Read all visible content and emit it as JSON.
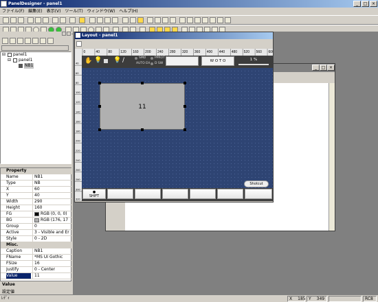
{
  "app": {
    "title": "PanelDesigner - panel1"
  },
  "menu": [
    "ファイル(F)",
    "編集(E)",
    "表示(V)",
    "ツール(T)",
    "ウィンドウ(W)",
    "ヘルプ(H)"
  ],
  "tree": {
    "root": "panel1",
    "child": "panel1",
    "leaf": "NB1"
  },
  "properties": {
    "header": "Property",
    "rows": [
      [
        "Name",
        "NB1"
      ],
      [
        "Type",
        "NB"
      ],
      [
        "X",
        "60"
      ],
      [
        "Y",
        "40"
      ],
      [
        "Width",
        "290"
      ],
      [
        "Height",
        "160"
      ],
      [
        "FG",
        "RGB (0, 0, 0)"
      ],
      [
        "BG",
        "RGB (176, 17"
      ],
      [
        "Group",
        "0"
      ],
      [
        "Active",
        "3 - Visible and Er"
      ],
      [
        "Style",
        "0 - 2D"
      ]
    ],
    "misc_header": "Misc.",
    "misc_rows": [
      [
        "Caption",
        "NB1"
      ],
      [
        "FName",
        "*MS UI Gothic"
      ],
      [
        "FSize",
        "16"
      ],
      [
        "Justify",
        "0 - Center"
      ],
      [
        "Value",
        "11"
      ]
    ],
    "fg_color": "#000000",
    "bg_color": "#b0b0b0"
  },
  "desc": {
    "title": "Value",
    "text": "設定値"
  },
  "layout_window": {
    "title": "Layout - panel1"
  },
  "ruler_marks": [
    "0",
    "40",
    "80",
    "120",
    "160",
    "200",
    "240",
    "280",
    "320",
    "360",
    "400",
    "440",
    "480",
    "520",
    "560",
    "600"
  ],
  "ruler_v_marks": [
    "40",
    "60",
    "80",
    "100",
    "120",
    "140",
    "160",
    "180",
    "200",
    "220",
    "240",
    "260",
    "280",
    "300",
    "320"
  ],
  "top_strip": {
    "smd": "SMD",
    "pprot": "PPROT",
    "auto_eh": "AUTO EH",
    "d_sw": "D SW",
    "wot": "W O T O",
    "percent": "1 %"
  },
  "numeric_box": {
    "value": "11",
    "fill": "#b0b0b0"
  },
  "shortcut": "Shotcut",
  "bottom_buttons": [
    "SHIFT",
    "",
    "",
    "",
    "",
    "",
    "",
    ""
  ],
  "status": {
    "left": "ﾚﾃﾞｨ",
    "x": "X",
    "x_val": "185",
    "y": "Y",
    "y_val": "349",
    "mode": "RC8"
  }
}
